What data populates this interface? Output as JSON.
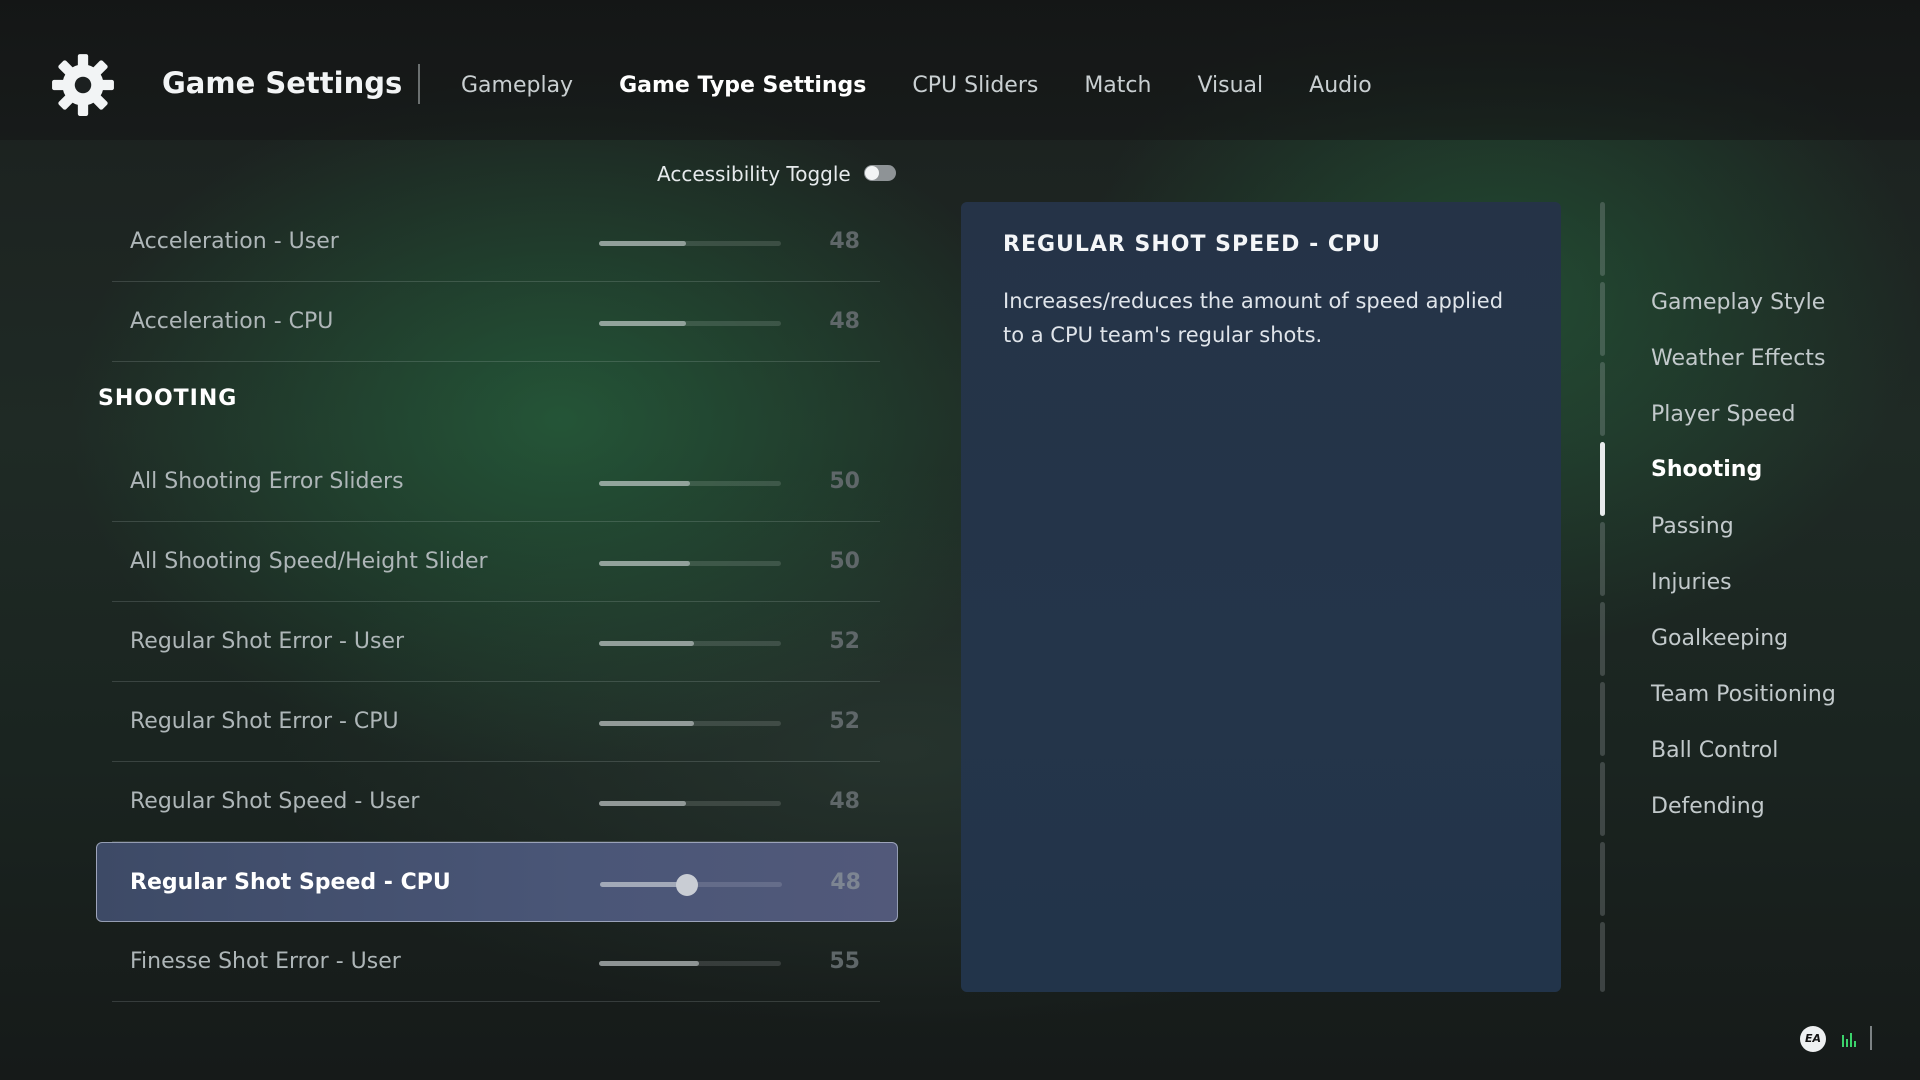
{
  "header": {
    "title": "Game Settings",
    "icon": "gear-icon",
    "tabs": [
      {
        "label": "Gameplay",
        "active": false
      },
      {
        "label": "Game Type Settings",
        "active": true
      },
      {
        "label": "CPU Sliders",
        "active": false
      },
      {
        "label": "Match",
        "active": false
      },
      {
        "label": "Visual",
        "active": false
      },
      {
        "label": "Audio",
        "active": false
      }
    ]
  },
  "accessibility": {
    "label": "Accessibility Toggle",
    "on": false
  },
  "section_title": "SHOOTING",
  "sliders": [
    {
      "label": "Acceleration - User",
      "value": "48"
    },
    {
      "label": "Acceleration - CPU",
      "value": "48"
    },
    {
      "label": "All Shooting Error Sliders",
      "value": "50"
    },
    {
      "label": "All Shooting Speed/Height Slider",
      "value": "50"
    },
    {
      "label": "Regular Shot Error - User",
      "value": "52"
    },
    {
      "label": "Regular Shot Error - CPU",
      "value": "52"
    },
    {
      "label": "Regular Shot Speed - User",
      "value": "48"
    },
    {
      "label": "Regular Shot Speed - CPU",
      "value": "48",
      "selected": true
    },
    {
      "label": "Finesse Shot Error - User",
      "value": "55"
    }
  ],
  "description": {
    "title": "REGULAR SHOT SPEED - CPU",
    "text": "Increases/reduces the amount of speed applied to a CPU team's regular shots."
  },
  "side_nav": {
    "items": [
      {
        "label": "Gameplay Style",
        "active": false
      },
      {
        "label": "Weather Effects",
        "active": false
      },
      {
        "label": "Player Speed",
        "active": false
      },
      {
        "label": "Shooting",
        "active": true
      },
      {
        "label": "Passing",
        "active": false
      },
      {
        "label": "Injuries",
        "active": false
      },
      {
        "label": "Goalkeeping",
        "active": false
      },
      {
        "label": "Team Positioning",
        "active": false
      },
      {
        "label": "Ball Control",
        "active": false
      },
      {
        "label": "Defending",
        "active": false
      }
    ]
  },
  "footer": {
    "logo_text": "EA",
    "icons": [
      "ea-logo-icon",
      "signal-bars-icon"
    ],
    "accent_color": "#3bd36b"
  }
}
